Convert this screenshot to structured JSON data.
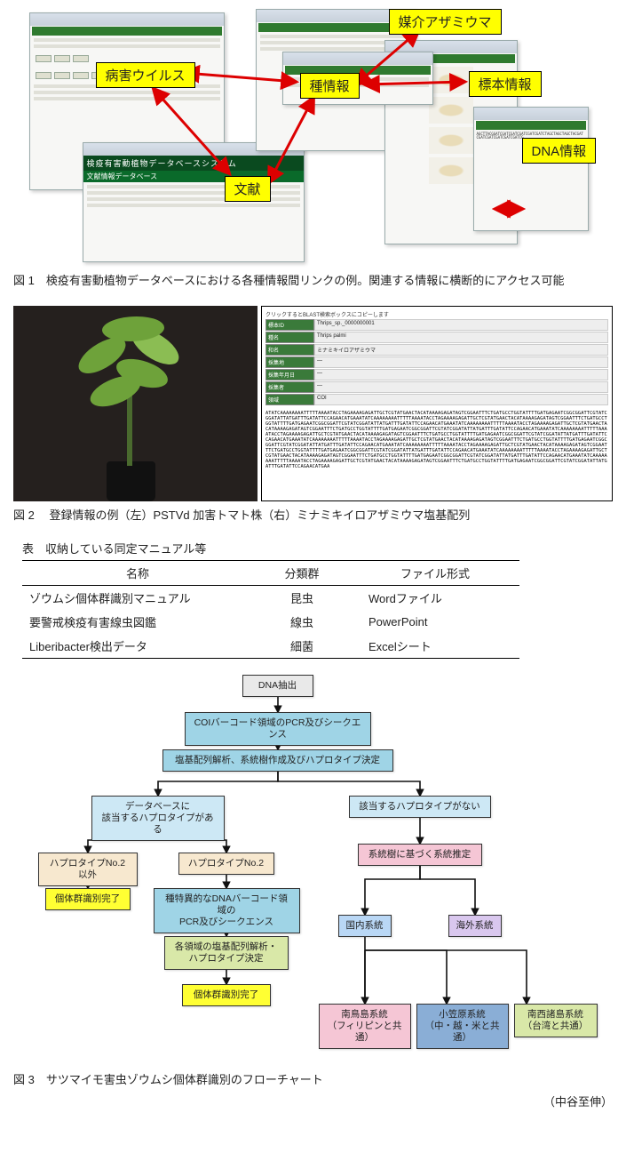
{
  "fig1": {
    "caption": "図 1　検疫有害動植物データベースにおける各種情報間リンクの例。関連する情報に横断的にアクセス可能",
    "labels": {
      "virus": "病害ウイルス",
      "species": "種情報",
      "vector": "媒介アザミウマ",
      "specimen": "標本情報",
      "dna": "DNA情報",
      "literature": "文献"
    },
    "system_title": "検疫有害動植物データベースシステム",
    "system_subtitle": "文献情報データベース"
  },
  "fig2": {
    "caption": "図 2　 登録情報の例（左）PSTVd 加害トマト株（右）ミナミキイロアザミウマ塩基配列",
    "seq_header": "クリックするとBLAST検索ボックスにコピーします",
    "meta": [
      {
        "k": "標本ID",
        "v": "Thrips_sp._0000000001"
      },
      {
        "k": "種名",
        "v": "Thrips palmi"
      },
      {
        "k": "和名",
        "v": "ミナミキイロアザミウマ"
      },
      {
        "k": "採集地",
        "v": "—"
      },
      {
        "k": "採集年月日",
        "v": "—"
      },
      {
        "k": "採集者",
        "v": "—"
      },
      {
        "k": "領域",
        "v": "COI"
      }
    ],
    "sequence_line": "ATATCAAAAAAAATTTTTAAAATACCTAGAAAAGAGATTGCTCGTATGAACTACATAAAAGAGATAGTCGGAATTTCTGATGCCTGGTATTTTGATGAGAATCGGCGGATTCGTATCGGATATTATGATTTGATATTCCAGAACATGAA",
    "sequence_rows": 8
  },
  "table": {
    "title": "表　収納している同定マニュアル等",
    "headers": {
      "name": "名称",
      "group": "分類群",
      "format": "ファイル形式"
    },
    "rows": [
      {
        "name": "ゾウムシ個体群識別マニュアル",
        "group": "昆虫",
        "format": "Wordファイル"
      },
      {
        "name": "要警戒検疫有害線虫図鑑",
        "group": "線虫",
        "format": "PowerPoint"
      },
      {
        "name": "Liberibacter検出データ",
        "group": "細菌",
        "format": "Excelシート"
      }
    ]
  },
  "fig3": {
    "caption": "図 3　サツマイモ害虫ゾウムシ個体群識別のフローチャート",
    "nodes": {
      "n1": "DNA抽出",
      "n2": "COIバーコード領域のPCR及びシークエンス",
      "n3": "塩基配列解析、系統樹作成及びハプロタイプ決定",
      "n4": "データベースに\n該当するハプロタイプがある",
      "n5": "該当するハプロタイプがない",
      "n6": "ハプロタイプNo.2以外",
      "n7": "ハプロタイプNo.2",
      "n8": "個体群識別完了",
      "n9": "種特異的なDNAバーコード領域の\nPCR及びシークエンス",
      "n10": "各領域の塩基配列解析・\nハプロタイプ決定",
      "n11": "個体群識別完了",
      "n12": "系統樹に基づく系統推定",
      "n13": "国内系統",
      "n14": "海外系統",
      "n15": "南鳥島系統\n（フィリピンと共通）",
      "n16": "小笠原系統\n（中・越・米と共通）",
      "n17": "南西諸島系統\n（台湾と共通）"
    }
  },
  "author": "（中谷至伸）"
}
